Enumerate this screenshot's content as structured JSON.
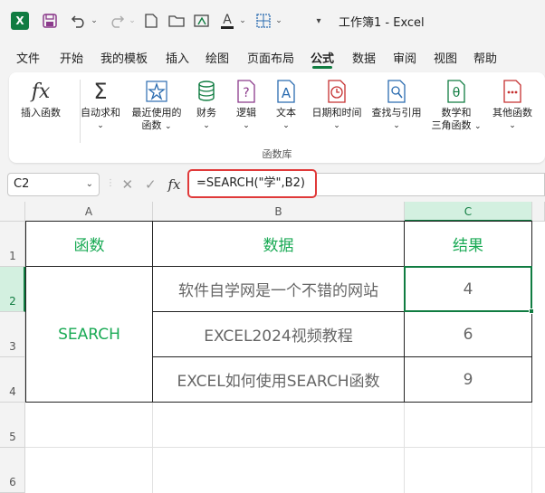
{
  "window": {
    "title": "工作簿1 - Excel",
    "app_icon": "X"
  },
  "menu": {
    "items": [
      "文件",
      "开始",
      "我的模板",
      "插入",
      "绘图",
      "页面布局",
      "公式",
      "数据",
      "审阅",
      "视图",
      "帮助"
    ],
    "active": "公式"
  },
  "ribbon": {
    "buttons": [
      {
        "label": "插入函数",
        "icon": "fx-icon"
      },
      {
        "label": "自动求和",
        "icon": "sigma-icon"
      },
      {
        "label": "最近使用的函数",
        "label1": "最近使用的",
        "label2": "函数",
        "icon": "star-icon"
      },
      {
        "label": "财务",
        "icon": "coins-icon"
      },
      {
        "label": "逻辑",
        "icon": "question-icon"
      },
      {
        "label": "文本",
        "icon": "text-a-icon"
      },
      {
        "label": "日期和时间",
        "icon": "clock-icon"
      },
      {
        "label": "查找与引用",
        "icon": "magnifier-icon"
      },
      {
        "label": "数学和三角函数",
        "label1": "数学和",
        "label2": "三角函数",
        "icon": "theta-icon"
      },
      {
        "label": "其他函数",
        "icon": "more-icon"
      }
    ],
    "group_label": "函数库"
  },
  "formula_bar": {
    "name_box": "C2",
    "fx": "fx",
    "formula": "=SEARCH(\"学\",B2)"
  },
  "grid": {
    "columns": [
      "A",
      "B",
      "C"
    ],
    "rows": [
      "1",
      "2",
      "3",
      "4",
      "5",
      "6"
    ],
    "header_row": [
      "函数",
      "数据",
      "结果"
    ],
    "merged_a": "SEARCH",
    "data": [
      {
        "b": "软件自学网是一个不错的网站",
        "c": "4"
      },
      {
        "b": "EXCEL2024视频教程",
        "c": "6"
      },
      {
        "b": "EXCEL如何使用SEARCH函数",
        "c": "9"
      }
    ]
  },
  "colors": {
    "accent": "#107c41",
    "text_green": "#1aaa55",
    "highlight_red": "#e03a3a"
  }
}
